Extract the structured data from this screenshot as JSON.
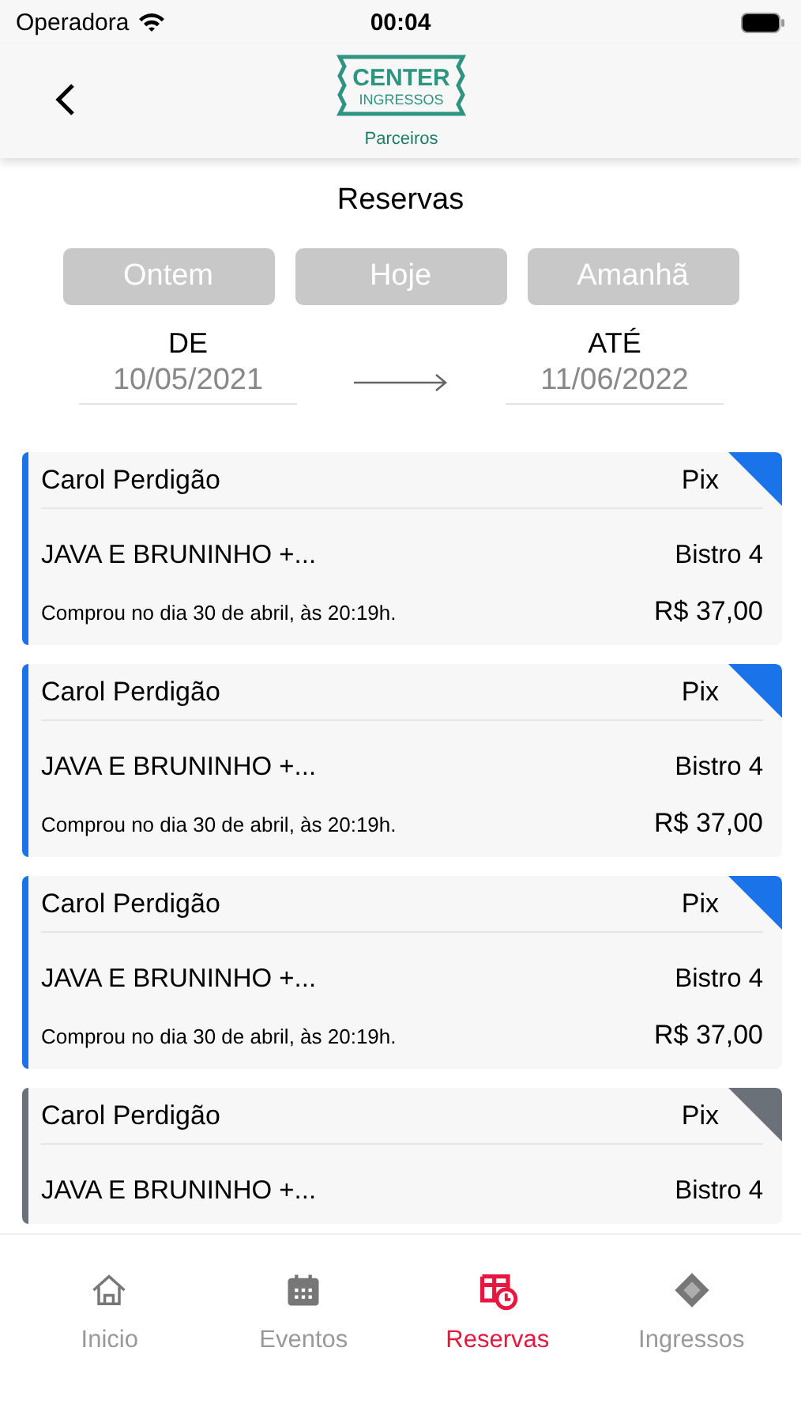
{
  "status_bar": {
    "carrier": "Operadora",
    "time": "00:04"
  },
  "header": {
    "logo_line1": "CENTER",
    "logo_line2": "INGRESSOS",
    "logo_subtitle": "Parceiros"
  },
  "title": "Reservas",
  "quick_filters": [
    {
      "label": "Ontem"
    },
    {
      "label": "Hoje"
    },
    {
      "label": "Amanhã"
    }
  ],
  "date_range": {
    "from_label": "DE",
    "from": "10/05/2021",
    "to_label": "ATÉ",
    "to": "11/06/2022"
  },
  "reservations": [
    {
      "name": "Carol Perdigão",
      "payment": "Pix",
      "event": "JAVA E BRUNINHO +...",
      "place": "Bistro 4",
      "purchased": "Comprou no dia 30 de abril, às 20:19h.",
      "price": "R$ 37,00",
      "color": "#1a73e8"
    },
    {
      "name": "Carol Perdigão",
      "payment": "Pix",
      "event": "JAVA E BRUNINHO +...",
      "place": "Bistro 4",
      "purchased": "Comprou no dia 30 de abril, às 20:19h.",
      "price": "R$ 37,00",
      "color": "#1a73e8"
    },
    {
      "name": "Carol Perdigão",
      "payment": "Pix",
      "event": "JAVA E BRUNINHO +...",
      "place": "Bistro 4",
      "purchased": "Comprou no dia 30 de abril, às 20:19h.",
      "price": "R$ 37,00",
      "color": "#1a73e8"
    },
    {
      "name": "Carol Perdigão",
      "payment": "Pix",
      "event": "JAVA E BRUNINHO +...",
      "place": "Bistro 4",
      "color": "#6b7178"
    }
  ],
  "tabs": [
    {
      "label": "Inicio",
      "selected": false
    },
    {
      "label": "Eventos",
      "selected": false
    },
    {
      "label": "Reservas",
      "selected": true
    },
    {
      "label": "Ingressos",
      "selected": false
    }
  ]
}
